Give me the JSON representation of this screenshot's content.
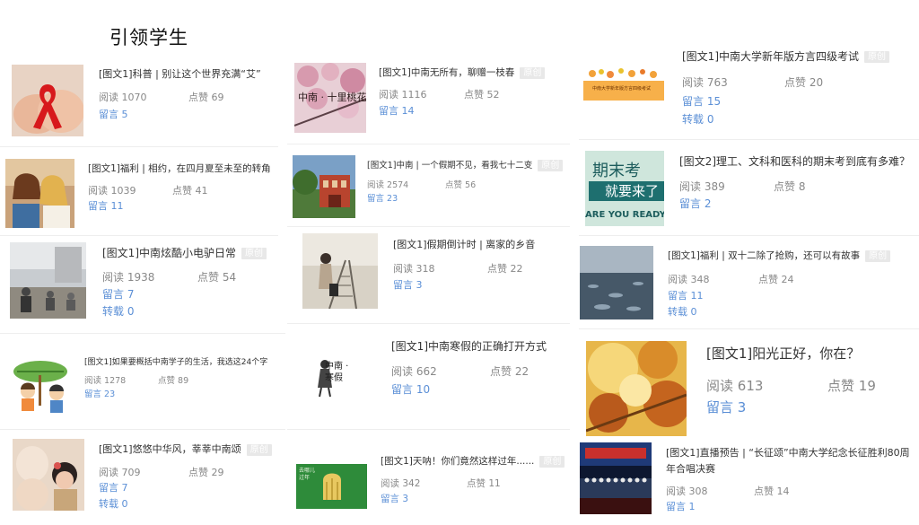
{
  "heading": "引领学生",
  "badge_label": "原创",
  "labels": {
    "read": "阅读",
    "like": "点赞",
    "comment": "留言",
    "share": "转载"
  },
  "articles": [
    {
      "title": "[图文1]科普 | 别让这个世界充满“艾”",
      "read": "1070",
      "like": "69",
      "comment": "5",
      "original": false
    },
    {
      "title": "[图文1]福利 | 相约，在四月夏至未至的转角",
      "read": "1039",
      "like": "41",
      "comment": "11",
      "original": false
    },
    {
      "title": "[图文1]中南炫酷小电驴日常",
      "read": "1938",
      "like": "54",
      "comment": "7",
      "share": "0",
      "original": true
    },
    {
      "title": "[图文1]如果要概括中南学子的生活，我选这24个字",
      "read": "1278",
      "like": "89",
      "comment": "23",
      "original": false
    },
    {
      "title": "[图文1]悠悠中华风，莘莘中南颂",
      "read": "709",
      "like": "29",
      "comment": "7",
      "share": "0",
      "original": true
    },
    {
      "title": "[图文1]中南无所有，聊赠一枝春",
      "read": "1116",
      "like": "52",
      "comment": "14",
      "original": true
    },
    {
      "title": "[图文1]中南 | 一个假期不见，看我七十二变",
      "read": "2574",
      "like": "56",
      "comment": "23",
      "original": true
    },
    {
      "title": "[图文1]假期倒计时 | 离家的乡音",
      "read": "318",
      "like": "22",
      "comment": "3",
      "original": false
    },
    {
      "title": "[图文1]中南寒假的正确打开方式",
      "read": "662",
      "like": "22",
      "comment": "10",
      "original": false
    },
    {
      "title": "[图文1]天呐！你们竟然这样过年......",
      "read": "342",
      "like": "11",
      "comment": "3",
      "original": true
    },
    {
      "title": "[图文1]中南大学新年版方言四级考试",
      "read": "763",
      "like": "20",
      "comment": "15",
      "share": "0",
      "original": true
    },
    {
      "title": "[图文2]理工、文科和医科的期末考到底有多难？",
      "read": "389",
      "like": "8",
      "comment": "2",
      "original": false
    },
    {
      "title": "[图文1]福利 | 双十二除了抢购，还可以有故事",
      "read": "348",
      "like": "24",
      "comment": "11",
      "share": "0",
      "original": true
    },
    {
      "title": "[图文1]阳光正好，你在？",
      "read": "613",
      "like": "19",
      "comment": "3",
      "original": false
    },
    {
      "title": "[图文1]直播预告 | “长征颂”中南大学纪念长征胜利80周年合唱决赛",
      "read": "308",
      "like": "14",
      "comment": "1",
      "original": false
    }
  ],
  "thumb_text": {
    "spring": "中南 · 十里桃花",
    "winter": "中南 · 寒假",
    "exam_banner": "中南大学新年版方言四级考试",
    "final_line1": "期末考",
    "final_line2": "就要来了",
    "final_line3": "ARE YOU READY",
    "newyear": "去哪儿过年"
  },
  "colors": {
    "link": "#5b8fd6",
    "stat": "#888888",
    "title": "#333333",
    "badge": "#e8e8e8"
  }
}
